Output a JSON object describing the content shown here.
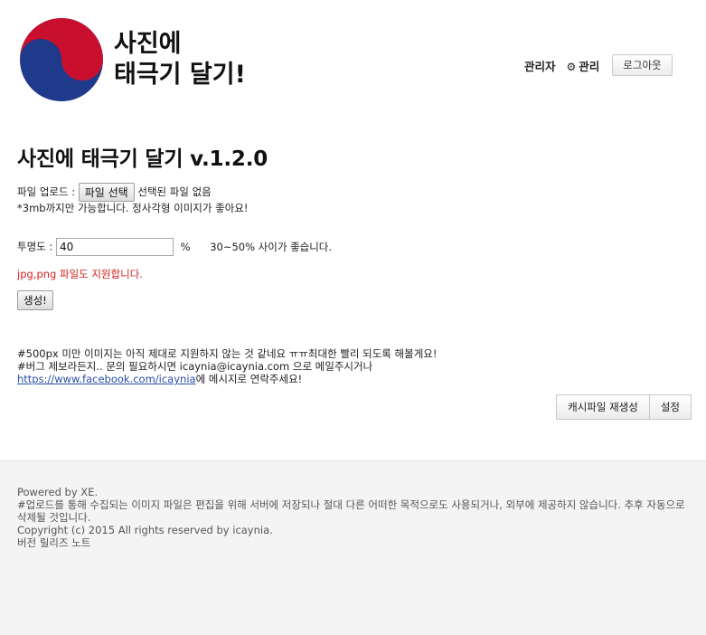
{
  "header": {
    "title_line1": "사진에",
    "title_line2": "태극기 달기!",
    "nav_admin_user": "관리자",
    "nav_manage": "관리",
    "logout_label": "로그아웃",
    "colors": {
      "red": "#c8102e",
      "blue": "#1f3a8a"
    }
  },
  "main": {
    "title": "사진에 태극기 달기 v.1.2.0",
    "upload_label": "파일 업로드 :",
    "file_button": "파일 선택",
    "file_status": "선택된 파일 없음",
    "size_note": "*3mb까지만 가능합니다. 정사각형 이미지가 좋아요!",
    "opacity_label": "투명도 :",
    "opacity_value": "40",
    "opacity_unit": "%",
    "opacity_hint": "30~50% 사이가 좋습니다.",
    "format_note": "jpg,png 파일도 지원합니다.",
    "generate_button": "생성!",
    "notice_line1": "#500px 미만 이미지는 아직 제대로 지원하지 않는 것 같네요 ㅠㅠ최대한 빨리 되도록 해볼게요!",
    "notice_line2": "#버그 제보라든지.. 문의 필요하시면 icaynia@icaynia.com 으로 메일주시거나",
    "notice_link": "https://www.facebook.com/icaynia",
    "notice_line3_suffix": "에 메시지로 연락주세요!",
    "cache_button": "캐시파일 재생성",
    "settings_button": "설정"
  },
  "footer": {
    "powered": "Powered by XE.",
    "disclaimer": "#업로드를 통해 수집되는 이미지 파일은 편집을 위해 서버에 저장되나 절대 다른 어떠한 목적으로도 사용되거나, 외부에 제공하지 않습니다. 추후 자동으로 삭제될 것입니다.",
    "copyright": "Copyright (c) 2015 All rights reserved by icaynia.",
    "release_notes": "버전 릴리즈 노트"
  }
}
